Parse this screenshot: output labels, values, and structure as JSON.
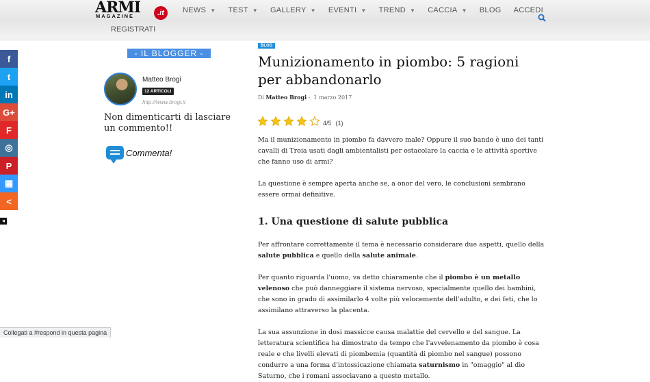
{
  "logo": {
    "armi": "ARMI",
    "magazine": "MAGAZINE",
    "it": ".it"
  },
  "nav": {
    "items": [
      {
        "label": "NEWS",
        "dropdown": true
      },
      {
        "label": "TEST",
        "dropdown": true
      },
      {
        "label": "GALLERY",
        "dropdown": true
      },
      {
        "label": "EVENTI",
        "dropdown": true
      },
      {
        "label": "TREND",
        "dropdown": true
      },
      {
        "label": "CACCIA",
        "dropdown": true
      },
      {
        "label": "BLOG",
        "dropdown": false
      },
      {
        "label": "ACCEDI",
        "dropdown": false
      }
    ],
    "registrati": "REGISTRATI",
    "search_icon": "search-icon"
  },
  "share": {
    "buttons": [
      {
        "name": "facebook",
        "glyph": "f",
        "color": "#3b5998"
      },
      {
        "name": "twitter",
        "glyph": "t",
        "color": "#1da1f2"
      },
      {
        "name": "linkedin",
        "glyph": "in",
        "color": "#0077b5"
      },
      {
        "name": "googleplus",
        "glyph": "G+",
        "color": "#dd4b39"
      },
      {
        "name": "flipboard",
        "glyph": "F",
        "color": "#e12828"
      },
      {
        "name": "instagram",
        "glyph": "◎",
        "color": "#3f729b"
      },
      {
        "name": "pinterest",
        "glyph": "P",
        "color": "#cb2027"
      },
      {
        "name": "delicious",
        "glyph": "▦",
        "color": "#3399ff"
      },
      {
        "name": "more",
        "glyph": "<",
        "color": "#f26522"
      }
    ]
  },
  "sidebar": {
    "blogger_title": "- IL BLOGGER -",
    "author_name": "Matteo Brogi",
    "articles_badge": "12 ARTICOLI",
    "author_url": "http://www.brogi.it",
    "reminder": "Non dimenticarti di lasciare un commento!!",
    "comment_label": "Commenta!"
  },
  "article": {
    "category": "BLOG",
    "title": "Munizionamento in piombo: 5 ragioni per abbandonarlo",
    "meta_by": "Di",
    "meta_author": "Matteo Brogi",
    "meta_sep": "-",
    "meta_date": "1 marzo 2017",
    "rating": {
      "value": 4,
      "max": 5,
      "score_text": "4/5",
      "count_text": "(1)"
    },
    "p1": "Ma il munizionamento in piombo fa davvero male? Oppure il suo bando è uno dei tanti cavalli di Troia usati dagli ambientalisti per ostacolare la caccia e le attività sportive che fanno uso di armi?",
    "p2": "La questione è sempre aperta anche se, a onor del vero, le conclusioni sembrano essere ormai definitive.",
    "h1": "1. Una questione di salute pubblica",
    "p3a": "Per affrontare correttamente il tema è necessario considerare due aspetti, quello della ",
    "p3b": "salute pubblica",
    "p3c": " e quello della ",
    "p3d": "salute animale",
    "p3e": ".",
    "p4a": "Per quanto riguarda l'uomo, va detto chiaramente che il ",
    "p4b": "piombo è un metallo velenoso",
    "p4c": " che può danneggiare il sistema nervoso, specialmente quello dei bambini, che sono in grado di assimilarlo 4 volte più velocemente dell'adulto, e dei feti, che lo assimilano attraverso la placenta.",
    "p5a": "La sua assunzione in dosi massicce causa malattie del cervello e del sangue. La letteratura scientifica ha dimostrato da tempo che l'avvelenamento da piombo è cosa reale e che livelli elevati di piombemia (quantità di piombo nel sangue) possono condurre a una forma d'intossicazione chiamata ",
    "p5b": "saturnismo",
    "p5c": " in \"omaggio\" al dio Saturno, che i romani associavano a questo metallo."
  },
  "status_bar": "Collegati a #respond in questa pagina"
}
